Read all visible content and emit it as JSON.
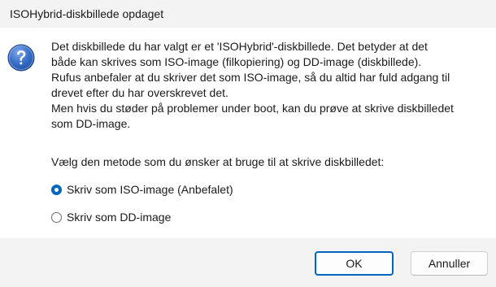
{
  "window": {
    "title": "ISOHybrid-diskbillede opdaget"
  },
  "dialog": {
    "icon": "question-icon",
    "message_lines": [
      "Det diskbillede du har valgt er et 'ISOHybrid'-diskbillede. Det betyder at det",
      "både kan skrives som ISO-image (filkopiering) og DD-image (diskbillede).",
      "Rufus anbefaler at du skriver det som ISO-image, så du altid har fuld adgang til",
      "drevet efter du har overskrevet det.",
      "Men hvis du støder på problemer under boot, kan du prøve at skrive diskbilledet",
      "som DD-image."
    ],
    "prompt": "Vælg den metode som du ønsker at bruge til at skrive diskbilledet:",
    "options": [
      {
        "label": "Skriv som ISO-image (Anbefalet)",
        "selected": true
      },
      {
        "label": "Skriv som DD-image",
        "selected": false
      }
    ]
  },
  "buttons": {
    "ok_label": "OK",
    "cancel_label": "Annuller"
  },
  "colors": {
    "accent": "#0067c0",
    "titlebar_bg": "#f3f3f3",
    "footer_bg": "#f3f3f3",
    "content_bg": "#ffffff",
    "icon_gradient_top": "#4f86d9",
    "icon_gradient_bottom": "#1f4ea6"
  }
}
